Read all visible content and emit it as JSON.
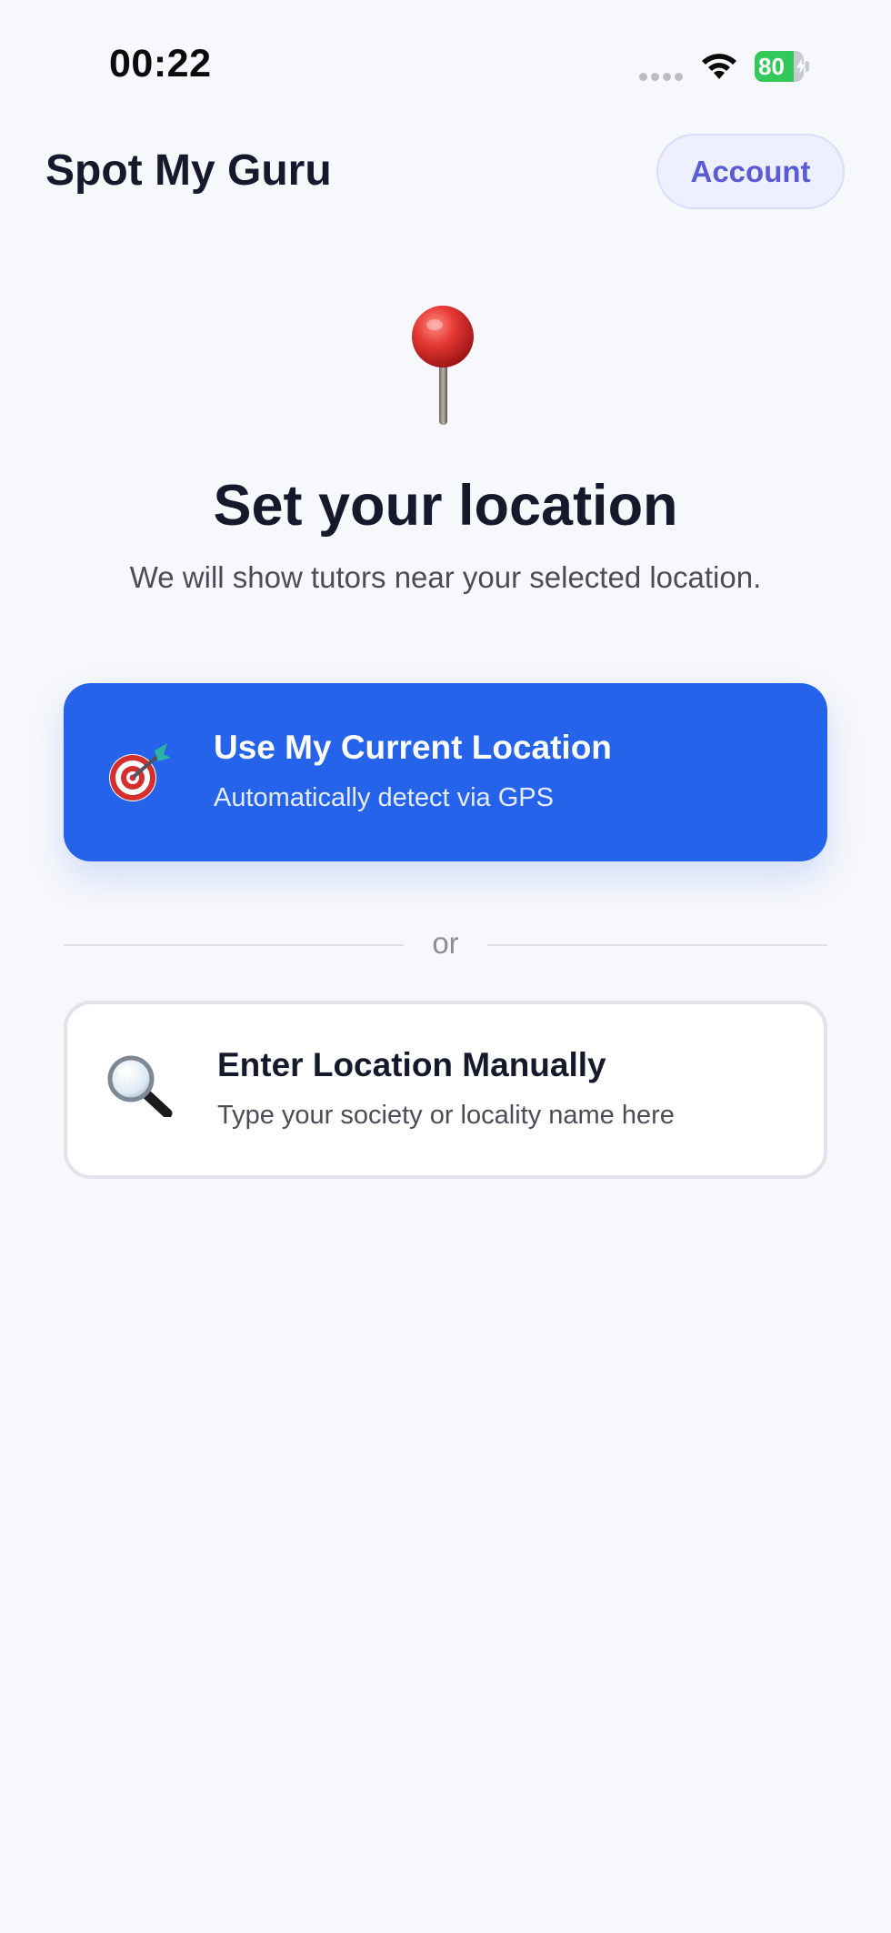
{
  "status_bar": {
    "time": "00:22",
    "battery_level": "80",
    "battery_fraction": 0.8,
    "battery_color": "#34c759",
    "icons": [
      "signal-dots-icon",
      "wifi-icon",
      "battery-icon",
      "charging-bolt-icon"
    ]
  },
  "header": {
    "title": "Spot My Guru",
    "account_label": "Account"
  },
  "hero": {
    "icon": "map-pin-icon",
    "title": "Set your location",
    "subtitle": "We will show tutors near your selected location."
  },
  "options": {
    "gps": {
      "icon": "target-dart-icon",
      "title": "Use My Current Location",
      "subtitle": "Automatically detect via GPS",
      "color": "#2563eb"
    },
    "divider_label": "or",
    "manual": {
      "icon": "magnifier-icon",
      "title": "Enter Location Manually",
      "subtitle": "Type your society or locality name here"
    }
  },
  "colors": {
    "background": "#f7f8fb",
    "accent": "#2563eb",
    "account_text": "#5b5bd6",
    "title_text": "#16182c"
  }
}
